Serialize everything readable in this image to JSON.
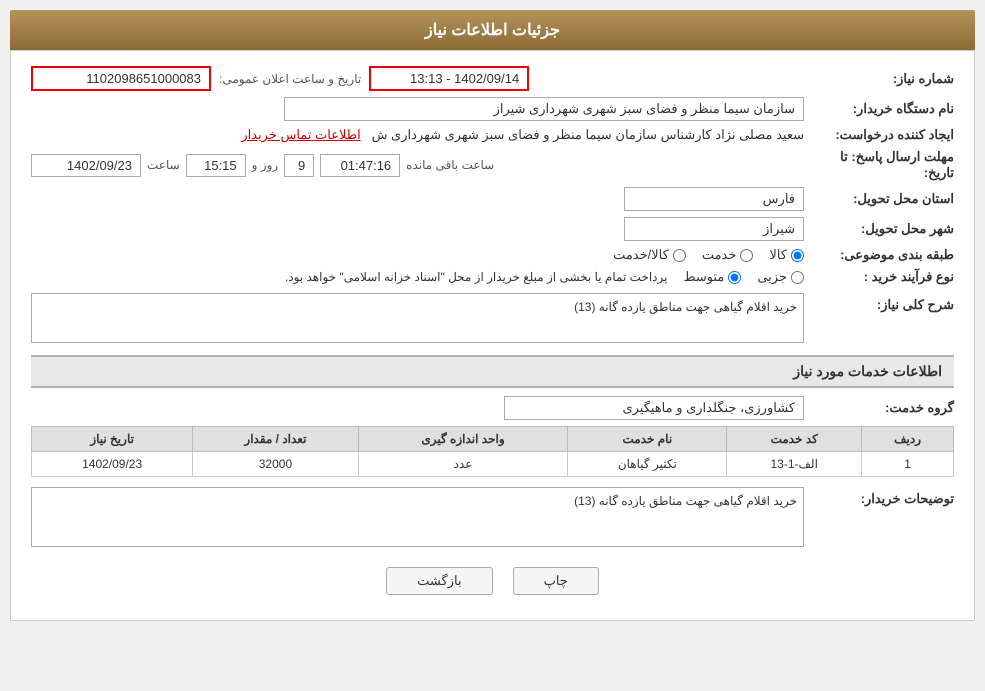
{
  "page": {
    "title": "جزئیات اطلاعات نیاز",
    "header": {
      "label": "جزئیات اطلاعات نیاز"
    }
  },
  "fields": {
    "need_number_label": "شماره نیاز:",
    "need_number_value": "1102098651000083",
    "announce_label": "تاریخ و ساعت اعلان عمومی:",
    "announce_value": "1402/09/14 - 13:13",
    "buyer_org_label": "نام دستگاه خریدار:",
    "buyer_org_value": "سازمان سیما منظر و فضای سبز شهری شهرداری شیراز",
    "creator_label": "ایجاد کننده درخواست:",
    "creator_value": "سعید مصلی نژاد کارشناس سازمان سیما منظر و فضای سبز شهری شهرداری ش",
    "contact_link": "اطلاعات تماس خریدار",
    "deadline_label": "مهلت ارسال پاسخ: تا تاریخ:",
    "deadline_date": "1402/09/23",
    "deadline_time_label": "ساعت",
    "deadline_time": "15:15",
    "deadline_day_label": "روز و",
    "deadline_days": "9",
    "deadline_remaining_label": "ساعت باقی مانده",
    "deadline_remaining": "01:47:16",
    "province_label": "استان محل تحویل:",
    "province_value": "فارس",
    "city_label": "شهر محل تحویل:",
    "city_value": "شیراز",
    "category_label": "طبقه بندی موضوعی:",
    "category_options": [
      "کالا",
      "خدمت",
      "کالا/خدمت"
    ],
    "category_selected": "کالا",
    "purchase_type_label": "نوع فرآیند خرید :",
    "purchase_type_options": [
      "جزیی",
      "متوسط"
    ],
    "purchase_type_note": "پرداخت تمام یا بخشی از مبلغ خریدار از محل \"اسناد خزانه اسلامی\" خواهد بود.",
    "need_desc_label": "شرح کلی نیاز:",
    "need_desc_value": "خرید اقلام گیاهی  جهت مناطق یازده گانه (13)",
    "services_section_title": "اطلاعات خدمات مورد نیاز",
    "service_group_label": "گروه خدمت:",
    "service_group_value": "کشاورزی، جنگلداری و ماهیگیری",
    "table": {
      "headers": [
        "ردیف",
        "کد خدمت",
        "نام خدمت",
        "واحد اندازه گیری",
        "تعداد / مقدار",
        "تاریخ نیاز"
      ],
      "rows": [
        {
          "row": "1",
          "code": "الف-1-13",
          "name": "تکثیر گیاهان",
          "unit": "عدد",
          "quantity": "32000",
          "date": "1402/09/23"
        }
      ]
    },
    "buyer_desc_label": "توضیحات خریدار:",
    "buyer_desc_value": "خرید اقلام گیاهی  جهت مناطق یازده گانه (13)",
    "btn_print": "چاپ",
    "btn_back": "بازگشت"
  }
}
